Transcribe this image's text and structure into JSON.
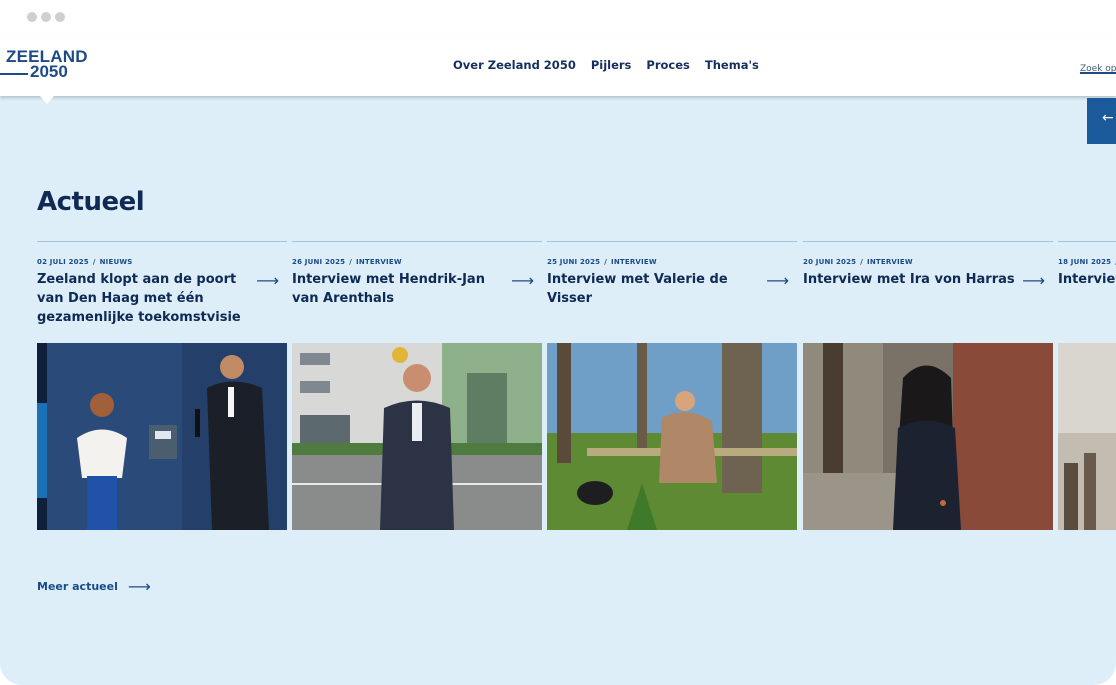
{
  "header": {
    "logo_line1": "ZEELAND",
    "logo_line2": "2050",
    "nav": [
      "Over Zeeland 2050",
      "Pijlers",
      "Proces",
      "Thema's"
    ],
    "search_placeholder": "Zoek op"
  },
  "section": {
    "title": "Actueel",
    "more_label": "Meer actueel"
  },
  "cards": [
    {
      "date": "02 JULI 2025",
      "category": "NIEUWS",
      "title": "Zeeland klopt aan de poort van Den Haag met één gezamenlijke toekomstvisie"
    },
    {
      "date": "26 JUNI 2025",
      "category": "INTERVIEW",
      "title": "Interview met Hendrik-Jan van Arenthals"
    },
    {
      "date": "25 JUNI 2025",
      "category": "INTERVIEW",
      "title": "Interview met Valerie de Visser"
    },
    {
      "date": "20 JUNI 2025",
      "category": "INTERVIEW",
      "title": "Interview met Ira von Harras"
    },
    {
      "date": "18 JUNI 2025",
      "category": "",
      "title": "Interview"
    }
  ],
  "symbols": {
    "arrow_right": "⟶",
    "arrow_left": "←",
    "sep": "/"
  },
  "colors": {
    "background": "#ddeef8",
    "brand_blue": "#1e4a86",
    "text_dark": "#0e2a55"
  }
}
